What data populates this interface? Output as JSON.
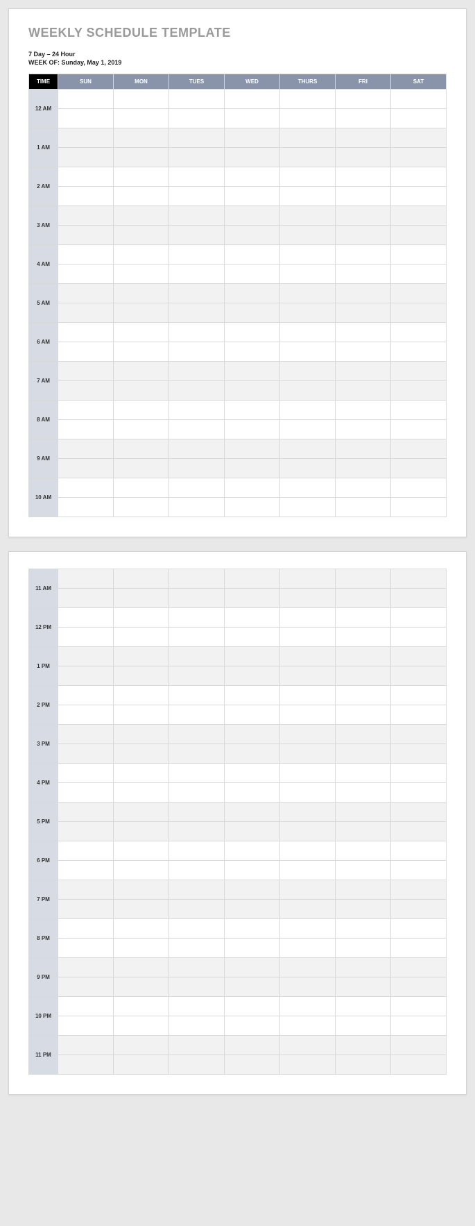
{
  "title": "WEEKLY SCHEDULE TEMPLATE",
  "meta": {
    "subtitle": "7 Day – 24 Hour",
    "week_of_label": "WEEK OF:",
    "week_of_value": "Sunday, May 1, 2019"
  },
  "headers": {
    "time": "TIME",
    "days": [
      "SUN",
      "MON",
      "TUES",
      "WED",
      "THURS",
      "FRI",
      "SAT"
    ]
  },
  "hours_page1": [
    "12 AM",
    "1 AM",
    "2 AM",
    "3 AM",
    "4 AM",
    "5 AM",
    "6 AM",
    "7 AM",
    "8 AM",
    "9 AM",
    "10 AM"
  ],
  "hours_page2": [
    "11 AM",
    "12 PM",
    "1 PM",
    "2 PM",
    "3 PM",
    "4 PM",
    "5 PM",
    "6 PM",
    "7 PM",
    "8 PM",
    "9 PM",
    "10 PM",
    "11 PM"
  ]
}
